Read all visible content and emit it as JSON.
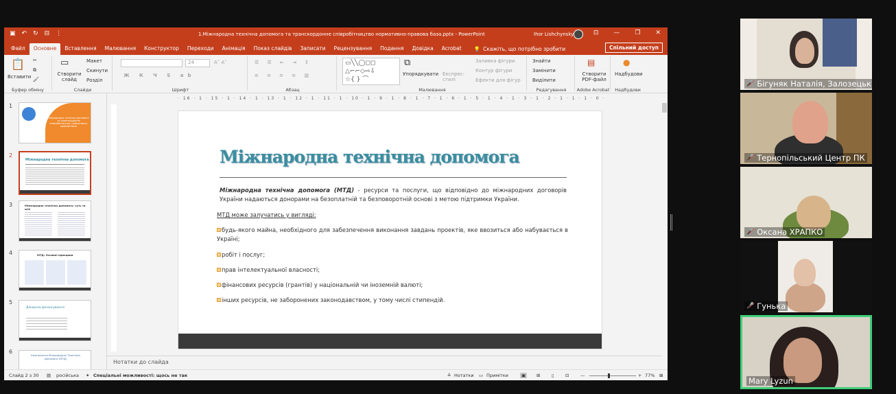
{
  "window": {
    "title": "1.Міжнародна технічна допомога та транскордонне співробітництво нормативно-правова база.pptx  -  PowerPoint",
    "user": "Ihor Lishchynskyy"
  },
  "tabs": [
    "Файл",
    "Основне",
    "Вставлення",
    "Малювання",
    "Конструктор",
    "Переходи",
    "Анімація",
    "Показ слайдів",
    "Записати",
    "Рецензування",
    "Подання",
    "Довідка",
    "Acrobat"
  ],
  "tell_me": "Скажіть, що потрібно зробити",
  "share": "Спільний доступ",
  "ribbon": {
    "clipboard": {
      "paste": "Вставити",
      "label": "Буфер обміну"
    },
    "slides": {
      "new": "Створити слайд",
      "layout": "Макет",
      "reset": "Скинути",
      "section": "Розділ",
      "label": "Слайди"
    },
    "font": {
      "size": "24",
      "label": "Шрифт"
    },
    "paragraph": {
      "label": "Абзац"
    },
    "drawing": {
      "arrange": "Упорядкувати",
      "styles": "Експрес-стилі",
      "fill": "Заливка фігури",
      "outline": "Контур фігури",
      "effects": "Ефекти для фігур",
      "label": "Малювання"
    },
    "editing": {
      "find": "Знайти",
      "replace": "Замінити",
      "select": "Виділити",
      "label": "Редагування"
    },
    "acrobat": {
      "pdf": "Створити PDF-файл",
      "label": "Adobe Acrobat"
    },
    "addins": {
      "btn": "Надбудови",
      "label": "Надбудови"
    }
  },
  "thumbnails": [
    {
      "num": "1",
      "title": "Міжнародна технічна допомога та транскордонне співробітництво: нормативно-правова база"
    },
    {
      "num": "2",
      "title": "Міжнародна технічна допомога"
    },
    {
      "num": "3",
      "title": "Міжнародна технічна допомога: суть та цілі"
    },
    {
      "num": "4",
      "title": "МТД: Основні принципи"
    },
    {
      "num": "5",
      "title": "Джерела фінансування"
    },
    {
      "num": "6",
      "title": "Компоненти Міжнародної Технічної Допомоги (МТД)"
    }
  ],
  "ruler": "· 16 · 1 · 15 · 1 · 14 · 1 · 13 · 1 · 12 · 1 · 11 · 1 · 10 · 1 · 9 · 1 · 8 · 1 · 7 · 1 · 6 · 1 · 5 · 1 · 4 · 1 · 3 · 1 · 2 · 1 · 1 · 1 · 0 · 1 · 1 · 1 · 2 · 1 · 3 · 1 · 4 · 1 · 5 · 1 · 6 · 1 · 7 · 1 · 8 · 1 · 9 · 1 · 10 · 1 · 11 · 1 · 12 · 1 · 13 · 1 · 14 · 1 · 15 · 1 · 16 ·",
  "slide": {
    "title": "Міжнародна технічна допомога",
    "term": "Міжнародна технічна допомога (МТД)",
    "definition": " - ресурси та послуги, що відповідно до міжнародних договорів України надаються донорами на безоплатній та безповоротній основі з метою підтримки України.",
    "subheading": "МТД може залучатись у вигляді:",
    "items": [
      "будь-якого майна, необхідного для забезпечення виконання завдань проектів, яке ввозиться або набувається в Україні;",
      "робіт і послуг;",
      "прав інтелектуальної власності;",
      "фінансових ресурсів (грантів) у національній чи іноземній валюті;",
      "інших ресурсів, не заборонених законодавством, у тому числі стипендій."
    ]
  },
  "notes": "Нотатки до слайда",
  "status": {
    "slide": "Слайд 2 з 30",
    "lang": "російська",
    "access": "Спеціальні можливості: щось не так",
    "notes": "Нотатки",
    "comments": "Примітки",
    "zoom": "77%"
  },
  "participants": [
    {
      "name": "Бігуняк Наталія, Залозецьк..."
    },
    {
      "name": "Тернопільський Центр ПК"
    },
    {
      "name": "Оксана ХРАПКО"
    },
    {
      "name": "Гунька"
    },
    {
      "name": "Mary Lyzun"
    }
  ],
  "colors": {
    "accent": "#c43e1c",
    "title": "#3a8ea0",
    "active_speaker": "#3fcf7a"
  }
}
